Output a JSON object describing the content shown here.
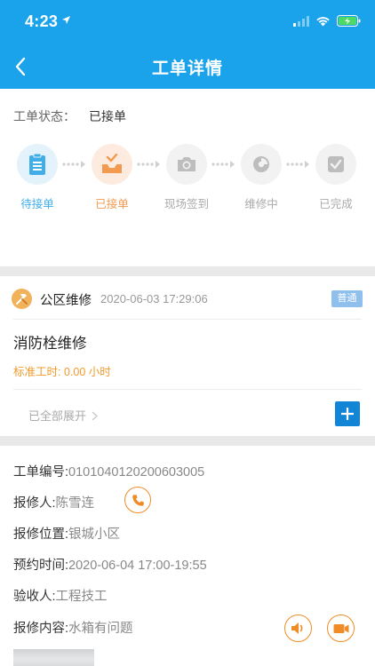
{
  "status_bar": {
    "time": "4:23"
  },
  "header": {
    "title": "工单详情"
  },
  "status": {
    "label": "工单状态：",
    "value": "已接单",
    "steps": [
      {
        "label": "待接单",
        "icon": "clipboard-icon",
        "state": "done",
        "color": "#41aee8"
      },
      {
        "label": "已接单",
        "icon": "inbox-icon",
        "state": "current",
        "color": "#f29a4f"
      },
      {
        "label": "现场签到",
        "icon": "camera-icon",
        "state": "pending",
        "color": "#bbbbbb"
      },
      {
        "label": "维修中",
        "icon": "repair-icon",
        "state": "pending",
        "color": "#bbbbbb"
      },
      {
        "label": "已完成",
        "icon": "check-box-icon",
        "state": "pending",
        "color": "#bbbbbb"
      }
    ]
  },
  "order": {
    "type": "公区维修",
    "created_at": "2020-06-03 17:29:06",
    "priority": "普通",
    "title": "消防栓维修",
    "standard_hours": "标准工时: 0.00 小时",
    "expand_label": "已全部展开"
  },
  "details": {
    "order_no": {
      "label": "工单编号:",
      "value": "0101040120200603005"
    },
    "reporter": {
      "label": "报修人:",
      "value": "陈雪连"
    },
    "location": {
      "label": "报修位置:",
      "value": "银城小区"
    },
    "appointment": {
      "label": "预约时间:",
      "value": "2020-06-04 17:00-19:55"
    },
    "inspector": {
      "label": "验收人:",
      "value": "工程技工"
    },
    "content": {
      "label": "报修内容:",
      "value": "水箱有问题"
    }
  },
  "colors": {
    "header": "#1aa3ea",
    "accent_orange": "#f08c25",
    "add_blue": "#1285d6"
  }
}
